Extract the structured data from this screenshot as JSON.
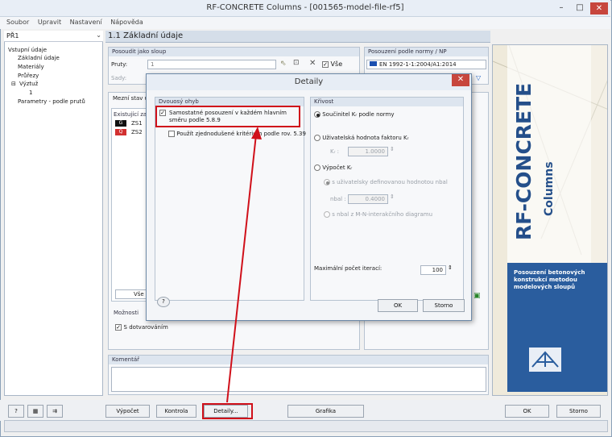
{
  "window": {
    "title": "RF-CONCRETE Columns - [001565-model-file-rf5]",
    "minimize": "–",
    "maximize": "□",
    "close": "✕"
  },
  "menu": [
    "Soubor",
    "Upravit",
    "Nastavení",
    "Nápověda"
  ],
  "nav": {
    "combo_value": "PŘ1",
    "tree": [
      "Vstupní údaje",
      "Základní údaje",
      "Materiály",
      "Průřezy",
      "Výztuž",
      "1",
      "Parametry - podle prutů"
    ]
  },
  "main": {
    "header": "1.1 Základní údaje",
    "posoudit_group": "Posoudit jako sloup",
    "pruty_label": "Pruty:",
    "pruty_value": "1",
    "sady_label": "Sady:",
    "vse_label": "Vše",
    "norm_group": "Posouzení podle normy / NP",
    "norm_value": "EN 1992-1-1:2004/A1:2014",
    "mezni_tab": "Mezní stav ú",
    "existujici": "Existující za",
    "zs1": "ZS1",
    "zs2": "ZS2",
    "vse2": "Vše",
    "moznosti": "Možnosti",
    "dotvarovani": "S dotvarováním",
    "komentar": "Komentář"
  },
  "side_image": {
    "brand": "RF-CONCRETE",
    "sub": "Columns",
    "desc": "Posouzení betonových konstrukcí metodou modelových sloupů"
  },
  "bottom": {
    "vypocet": "Výpočet",
    "kontrola": "Kontrola",
    "detaily": "Detaily...",
    "grafika": "Grafika",
    "ok": "OK",
    "storno": "Storno"
  },
  "dialog": {
    "title": "Detaily",
    "left_group": "Dvouosý ohyb",
    "cb1": "Samostatné posouzení v každém hlavním směru podle 5.8.9",
    "cb2": "Použít zjednodušené kritérium podle rov. 5.39",
    "right_group": "Křivost",
    "r1": "Součinitel Kᵣ podle normy",
    "r2": "Uživatelská hodnota faktoru Kᵣ",
    "kr_label": "Kᵣ :",
    "kr_value": "1.0000",
    "r3": "Výpočet Kᵣ",
    "r3a": "s uživatelsky definovanou hodnotou nbal",
    "nbal_label": "nbal :",
    "nbal_value": "0.4000",
    "r3b": "s nbal z M-N-interakčního diagramu",
    "iter_label": "Maximální počet iterací:",
    "iter_value": "100",
    "ok": "OK",
    "storno": "Storno"
  }
}
